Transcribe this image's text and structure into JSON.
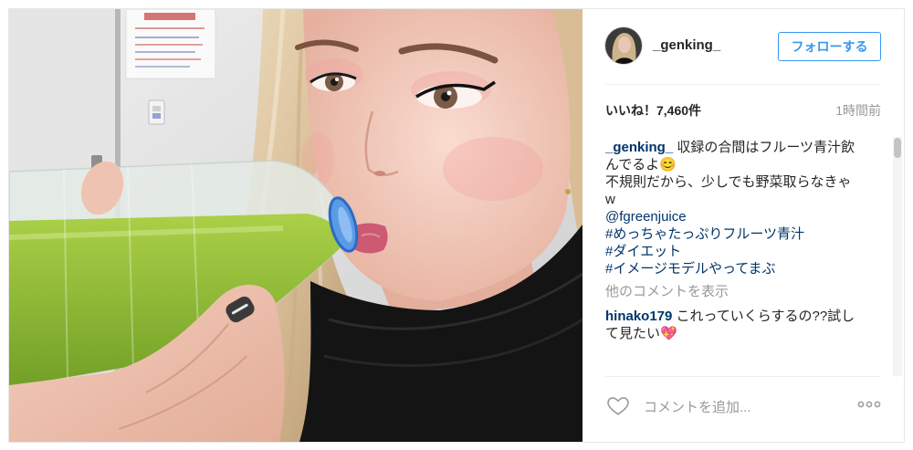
{
  "post": {
    "author": {
      "username": "_genking_"
    },
    "follow_label": "フォローする",
    "likes_label": "いいね！7,460件",
    "timestamp": "1時間前",
    "caption": {
      "username": "_genking_",
      "body": [
        "収録の合間はフルーツ青汁飲んでるよ😊",
        "不規則だから、少しでも野菜取らなきゃw"
      ],
      "mention": "@fgreenjuice",
      "hashtags": [
        "#めっちゃたっぷりフルーツ青汁",
        "#ダイエット",
        "#イメージモデルやってまぶ"
      ]
    },
    "more_comments_label": "他のコメントを表示",
    "comments": [
      {
        "username": "hinako179",
        "text": "これっていくらするの??試して見たい💖"
      }
    ],
    "add_comment_placeholder": "コメントを追加..."
  },
  "icons": {
    "like": "heart-icon",
    "more_options": "more-options-icon"
  },
  "colors": {
    "accent": "#3897f0",
    "link": "#003569",
    "text": "#262626",
    "muted": "#999999",
    "divider": "#efefef"
  }
}
